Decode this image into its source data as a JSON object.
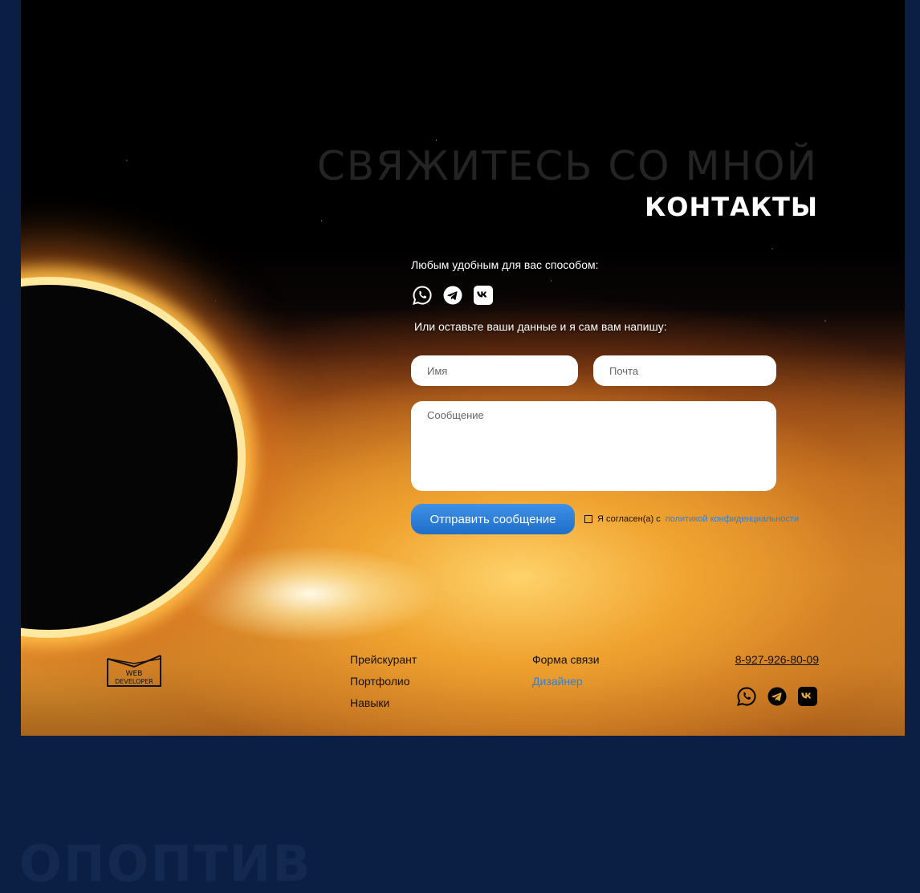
{
  "contacts": {
    "bg_title": "СВЯЖИТЕСЬ СО МНОЙ",
    "title": "КОНТАКТЫ",
    "any_way_text": "Любым удобным для вас способом:",
    "leave_data_text": "Или оставьте ваши данные и я сам вам напишу:",
    "social_icons": [
      "whatsapp-icon",
      "telegram-icon",
      "vk-icon"
    ],
    "form": {
      "name_placeholder": "Имя",
      "email_placeholder": "Почта",
      "message_placeholder": "Сообщение",
      "submit_label": "Отправить сообщение",
      "consent_text": "Я согласен(а) с",
      "consent_link": "политикой конфиденциальности"
    }
  },
  "footer": {
    "logo_text_1": "WEB",
    "logo_text_2": "DEVELOPER",
    "links_col1": [
      "Прейскурант",
      "Портфолио",
      "Навыки"
    ],
    "links_col2": [
      "Форма связи",
      "Дизайнер"
    ],
    "phone": "8-927-926-80-09"
  },
  "next_section": {
    "title": "ОПОПТИВ"
  },
  "colors": {
    "page_bg": "#0b1f45",
    "accent_blue": "#2f80d8",
    "button": "#2a7bd6"
  }
}
